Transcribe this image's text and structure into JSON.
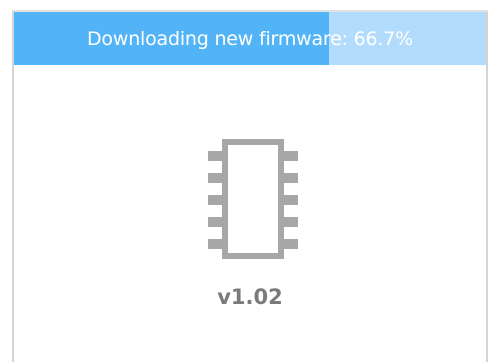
{
  "download": {
    "status_text": "Downloading new firmware: 66.7%",
    "progress_fraction": 0.667,
    "fill_color": "#52b3f7",
    "track_color": "#b3dbfb"
  },
  "firmware": {
    "icon": "chip-icon",
    "version": "v1.02",
    "text_color": "#7a7a7a"
  }
}
